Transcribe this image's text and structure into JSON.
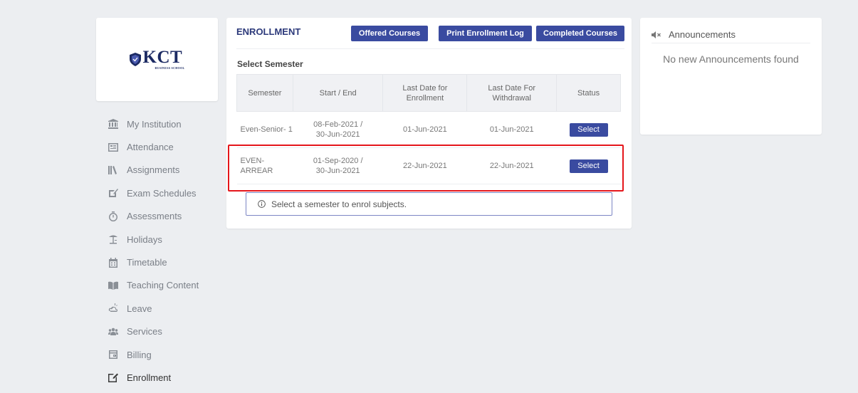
{
  "logo": {
    "main": "KCT",
    "sub": "BUSINESS SCHOOL"
  },
  "nav": {
    "items": [
      {
        "label": "My Institution",
        "icon": "institution-icon"
      },
      {
        "label": "Attendance",
        "icon": "attendance-icon"
      },
      {
        "label": "Assignments",
        "icon": "assignments-icon"
      },
      {
        "label": "Exam Schedules",
        "icon": "exam-icon"
      },
      {
        "label": "Assessments",
        "icon": "assessments-icon"
      },
      {
        "label": "Holidays",
        "icon": "holidays-icon"
      },
      {
        "label": "Timetable",
        "icon": "timetable-icon"
      },
      {
        "label": "Teaching Content",
        "icon": "teaching-content-icon"
      },
      {
        "label": "Leave",
        "icon": "leave-icon"
      },
      {
        "label": "Services",
        "icon": "services-icon"
      },
      {
        "label": "Billing",
        "icon": "billing-icon"
      },
      {
        "label": "Enrollment",
        "icon": "enrollment-icon",
        "active": true
      }
    ]
  },
  "enrollment": {
    "title": "ENROLLMENT",
    "buttons": {
      "offered": "Offered Courses",
      "print": "Print Enrollment Log",
      "completed": "Completed Courses"
    },
    "select_semester": "Select Semester",
    "table": {
      "headers": [
        "Semester",
        "Start / End",
        "Last Date for Enrollment",
        "Last Date For Withdrawal",
        "Status"
      ],
      "rows": [
        {
          "semester": "Even-Senior- 1",
          "start": "08-Feb-2021 /",
          "end": "30-Jun-2021",
          "last_enroll": "01-Jun-2021",
          "last_withdraw": "01-Jun-2021",
          "status": "Select"
        },
        {
          "semester": "EVEN-ARREAR",
          "start": "01-Sep-2020 /",
          "end": "30-Jun-2021",
          "last_enroll": "22-Jun-2021",
          "last_withdraw": "22-Jun-2021",
          "status": "Select"
        }
      ]
    },
    "info": "Select a semester to enrol subjects."
  },
  "announcements": {
    "title": "Announcements",
    "empty": "No new Announcements found"
  },
  "colors": {
    "primary": "#3a4ba0",
    "highlight": "#e5161b",
    "title": "#2d3a7b"
  }
}
